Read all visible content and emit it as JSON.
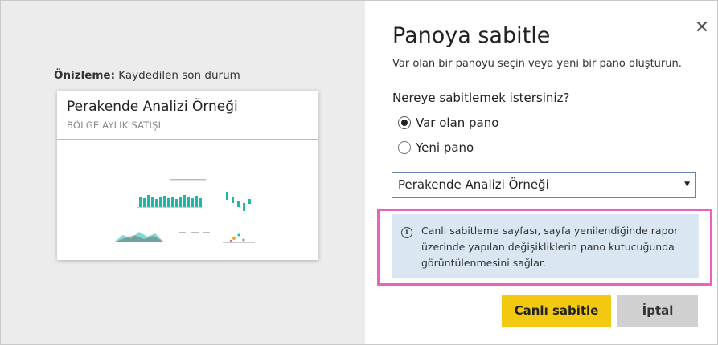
{
  "preview": {
    "caption_bold": "Önizleme:",
    "caption_rest": " Kaydedilen son durum",
    "tile_title": "Perakende Analizi Örneği",
    "tile_subtitle": "BÖLGE AYLIK SATIŞI"
  },
  "dialog": {
    "close_icon": "close-icon",
    "title": "Panoya sabitle",
    "subtitle": "Var olan bir panoyu seçin veya yeni bir pano oluşturun.",
    "question": "Nereye sabitlemek istersiniz?",
    "options": [
      {
        "label": "Var olan pano",
        "selected": true
      },
      {
        "label": "Yeni pano",
        "selected": false
      }
    ],
    "dashboard_select": {
      "value": "Perakende Analizi Örneği"
    },
    "info_icon": "info-icon",
    "info_text": "Canlı sabitleme sayfası, sayfa yenilendiğinde rapor üzerinde yapılan değişikliklerin pano kutucuğunda görüntülenmesini sağlar.",
    "primary_button": "Canlı sabitle",
    "secondary_button": "İptal"
  },
  "colors": {
    "primary_button": "#f2c811",
    "info_background": "#dae7f2",
    "highlight_border": "#ef5fbd",
    "chart_teal": "#1fb8a8",
    "left_panel_bg": "#ececec"
  }
}
